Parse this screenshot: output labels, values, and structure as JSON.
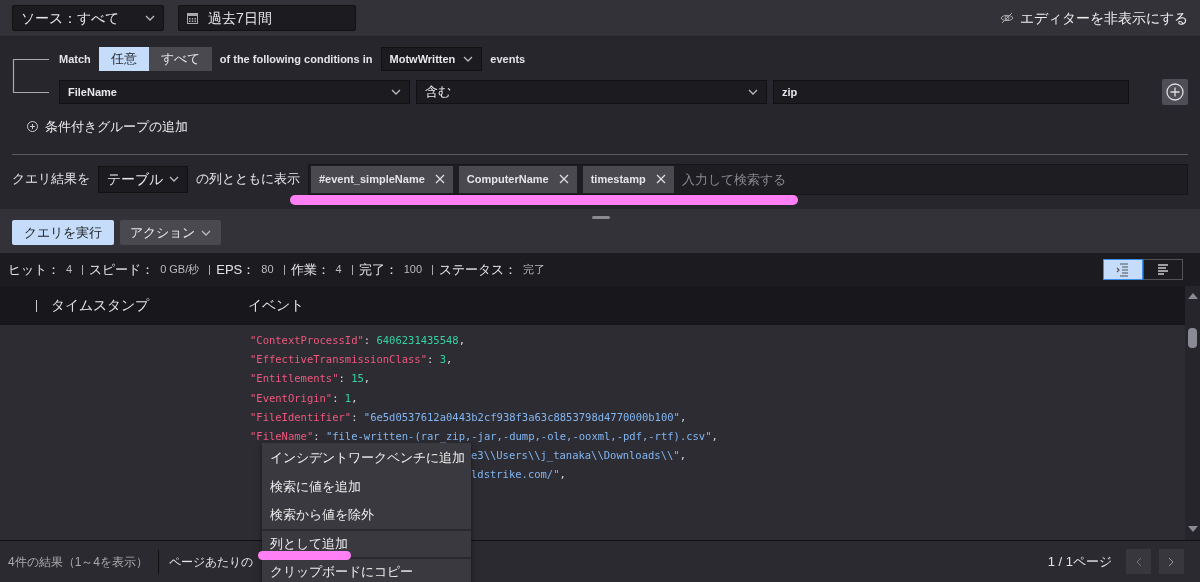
{
  "toolbar": {
    "source": "ソース：すべて",
    "date_range": "過去7日間",
    "hide_editor": "エディターを非表示にする"
  },
  "match": {
    "label": "Match",
    "options": [
      {
        "label": "任意",
        "selected": true
      },
      {
        "label": "すべて",
        "selected": false
      }
    ],
    "middle": "of the following conditions in",
    "event_type": "MotwWritten",
    "suffix": "events"
  },
  "condition": {
    "field": "FileName",
    "operator": "含む",
    "value": "zip"
  },
  "add_group": "条件付きグループの追加",
  "columns": {
    "label": "クエリ結果を",
    "view": "テーブル",
    "middle": "の列とともに表示",
    "tags": [
      "#event_simpleName",
      "ComputerName",
      "timestamp"
    ],
    "placeholder": "入力して検索する"
  },
  "actions": {
    "run": "クエリを実行",
    "action": "アクション"
  },
  "stats": [
    {
      "label": "ヒット：",
      "value": "4"
    },
    {
      "label": "スピード：",
      "value": "0 GB/秒"
    },
    {
      "label": "EPS：",
      "value": "80"
    },
    {
      "label": "作業：",
      "value": "4"
    },
    {
      "label": "完了：",
      "value": "100"
    },
    {
      "label": "ステータス：",
      "value": "完了"
    }
  ],
  "view_modes": [
    {
      "kind": "expanded",
      "selected": true
    },
    {
      "kind": "compact",
      "selected": false
    }
  ],
  "table": {
    "columns": [
      "タイムスタンプ",
      "イベント"
    ],
    "lines": [
      {
        "parts": [
          {
            "kind": "key",
            "text": "\"ContextProcessId\""
          },
          {
            "kind": "punct",
            "text": ": "
          },
          {
            "kind": "number",
            "text": "6406231435548"
          },
          {
            "kind": "punct",
            "text": ","
          }
        ]
      },
      {
        "parts": [
          {
            "kind": "key",
            "text": "\"EffectiveTransmissionClass\""
          },
          {
            "kind": "punct",
            "text": ": "
          },
          {
            "kind": "number",
            "text": "3"
          },
          {
            "kind": "punct",
            "text": ","
          }
        ]
      },
      {
        "parts": [
          {
            "kind": "key",
            "text": "\"Entitlements\""
          },
          {
            "kind": "punct",
            "text": ": "
          },
          {
            "kind": "number",
            "text": "15"
          },
          {
            "kind": "punct",
            "text": ","
          }
        ]
      },
      {
        "parts": [
          {
            "kind": "key",
            "text": "\"EventOrigin\""
          },
          {
            "kind": "punct",
            "text": ": "
          },
          {
            "kind": "number",
            "text": "1"
          },
          {
            "kind": "punct",
            "text": ","
          }
        ]
      },
      {
        "parts": [
          {
            "kind": "key",
            "text": "\"FileIdentifier\""
          },
          {
            "kind": "punct",
            "text": ": "
          },
          {
            "kind": "string",
            "text": "\"6e5d0537612a0443b2cf938f3a63c8853798d4770000b100\""
          },
          {
            "kind": "punct",
            "text": ","
          }
        ]
      },
      {
        "parts": [
          {
            "kind": "key",
            "text": "\"FileName\""
          },
          {
            "kind": "punct",
            "text": ": "
          },
          {
            "kind": "string",
            "text": "\"file-written-(rar_zip,-jar,-dump,-ole,-ooxml,-pdf,-rtf).csv\""
          },
          {
            "kind": "punct",
            "text": ","
          }
        ]
      }
    ],
    "lines_beside_menu": [
      {
        "parts": [
          {
            "kind": "string",
            "text": "e3\\\\Users\\\\j_tanaka\\\\Downloads\\\\\""
          },
          {
            "kind": "punct",
            "text": ","
          }
        ]
      },
      {
        "parts": [
          {
            "kind": "string",
            "text": "ldstrike.com/\""
          },
          {
            "kind": "punct",
            "text": ","
          }
        ]
      }
    ]
  },
  "context_menu": [
    {
      "label": "インシデントワークベンチに追加",
      "divider": false
    },
    {
      "label": "検索に値を追加",
      "divider": false
    },
    {
      "label": "検索から値を除外",
      "divider": false
    },
    {
      "label": "列として追加",
      "divider": true
    },
    {
      "label": "クリップボードにコピー",
      "divider": true
    }
  ],
  "footer": {
    "results": "4件の結果（1～4を表示）",
    "per_page": "ページあたりの",
    "pages": "1 / 1ページ"
  }
}
